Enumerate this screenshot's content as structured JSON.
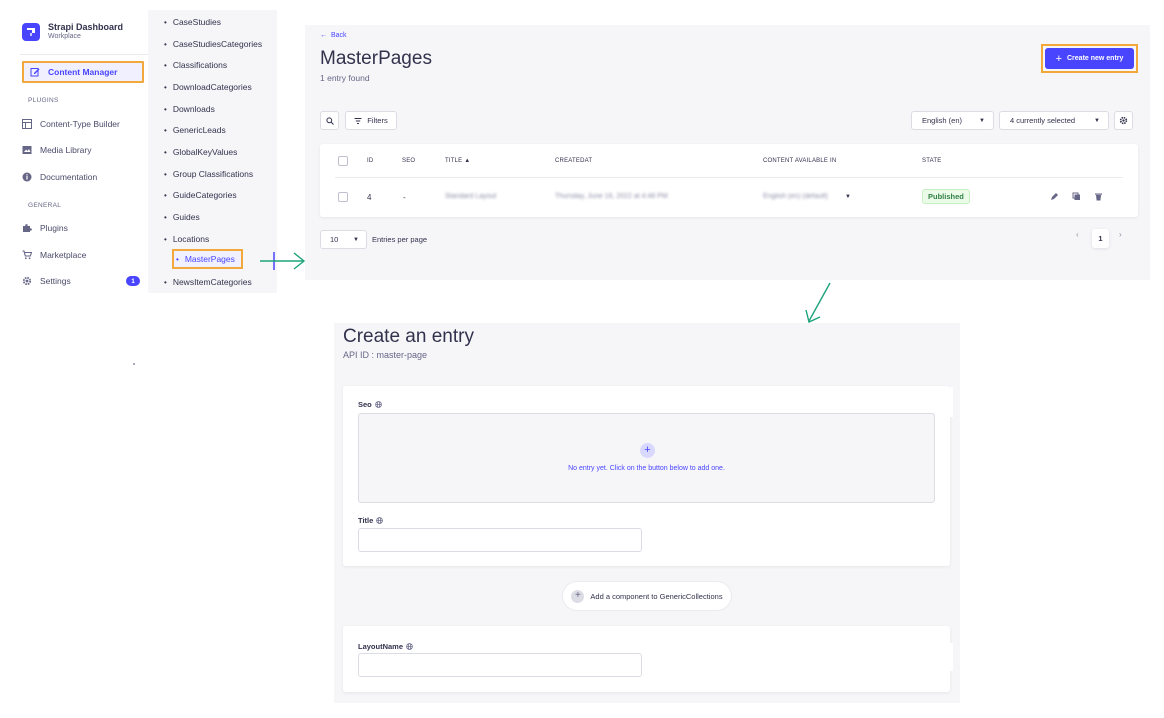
{
  "brand": {
    "name": "Strapi Dashboard",
    "workspace": "Workplace"
  },
  "sidebar": {
    "active_item": "Content Manager",
    "plugins_heading": "PLUGINS",
    "plugins": [
      "Content-Type Builder",
      "Media Library",
      "Documentation"
    ],
    "general_heading": "GENERAL",
    "general": [
      "Plugins",
      "Marketplace",
      "Settings"
    ],
    "settings_badge": "1"
  },
  "collections": {
    "items": [
      "CaseStudies",
      "CaseStudiesCategories",
      "Classifications",
      "DownloadCategories",
      "Downloads",
      "GenericLeads",
      "GlobalKeyValues",
      "Group Classifications",
      "GuideCategories",
      "Guides",
      "Locations",
      "MasterPages",
      "NewsItemCategories"
    ],
    "active": "MasterPages"
  },
  "list_view": {
    "back_label": "Back",
    "title": "MasterPages",
    "subtitle": "1 entry found",
    "create_label": "Create new entry",
    "filters_label": "Filters",
    "locale_select": "English (en)",
    "columns_select": "4 currently selected",
    "headers": {
      "id": "ID",
      "seo": "SEO",
      "title": "TITLE",
      "created_at": "CREATEDAT",
      "content_available": "CONTENT AVAILABLE IN",
      "state": "STATE"
    },
    "row": {
      "id": "4",
      "seo": "-",
      "title": "Standard Layout",
      "created_at": "Thursday, June 16, 2022 at 4:48 PM",
      "content_available": "English (en) (default)",
      "state": "Published"
    },
    "per_page_value": "10",
    "per_page_label": "Entries per page",
    "current_page": "1",
    "prev_glyph": "‹",
    "next_glyph": "›"
  },
  "create_view": {
    "title": "Create an entry",
    "api_id": "API ID : master-page",
    "seo_label": "Seo",
    "empty_text": "No entry yet. Click on the button below to add one.",
    "title_label": "Title",
    "add_component_label": "Add a component to GenericCollections",
    "layout_label": "LayoutName"
  },
  "colors": {
    "primary": "#4945ff",
    "highlight": "#f2a83b",
    "arrow": "#1fa37c",
    "success": "#328048"
  }
}
